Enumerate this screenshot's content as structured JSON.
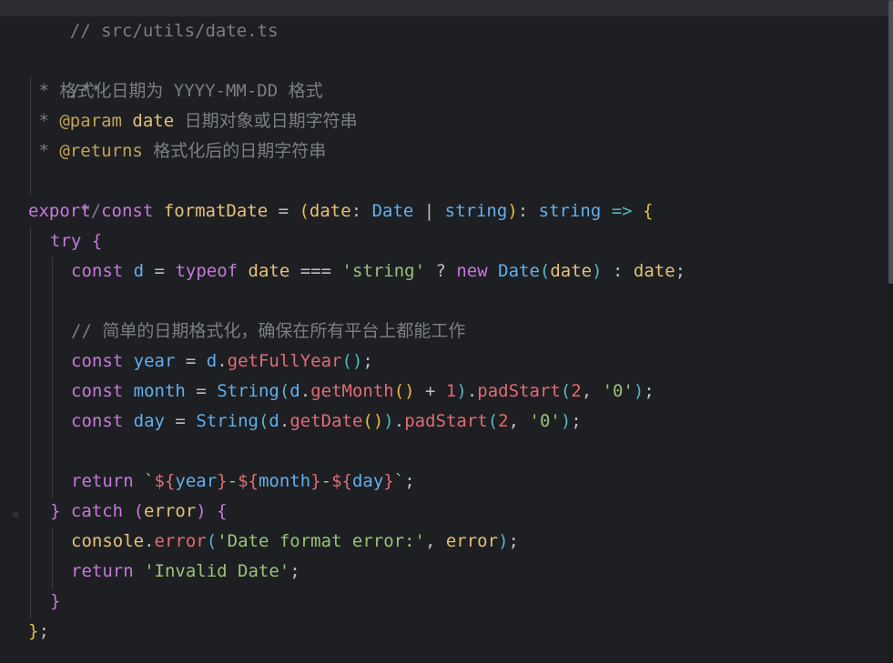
{
  "editor": {
    "file_path_comment": "// src/utils/date.ts",
    "doc": {
      "open": "/**",
      "line1_star": " * ",
      "line1_text": "格式化日期为 YYYY-MM-DD 格式",
      "line2_star": " * ",
      "line2_tag": "@param",
      "line2_name": "date",
      "line2_text": "日期对象或日期字符串",
      "line3_star": " * ",
      "line3_tag": "@returns",
      "line3_text": "格式化后的日期字符串",
      "close": " */"
    },
    "sig": {
      "export": "export",
      "const": "const",
      "name": "formatDate",
      "eq": " = ",
      "lp": "(",
      "param": "date",
      "colon": ": ",
      "type1": "Date",
      "bar": " | ",
      "type2": "string",
      "rp": ")",
      "colon2": ": ",
      "ret": "string",
      "arrow": " => ",
      "brace": "{"
    },
    "try_kw": "try",
    "try_brace": "{",
    "line_d": {
      "const": "const",
      "name": "d",
      "eq": " = ",
      "typeof": "typeof",
      "date": "date",
      "eqq": " === ",
      "str": "'string'",
      "q": " ? ",
      "new": "new",
      "Date": "Date",
      "lp": "(",
      "arg": "date",
      "rp": ")",
      "colon": " : ",
      "alt": "date",
      "semi": ";"
    },
    "comment2": "// 简单的日期格式化，确保在所有平台上都能工作",
    "line_year": {
      "const": "const",
      "name": "year",
      "eq": " = ",
      "obj": "d",
      "dot": ".",
      "meth": "getFullYear",
      "parens": "()",
      "semi": ";"
    },
    "line_month": {
      "const": "const",
      "name": "month",
      "eq": " = ",
      "String": "String",
      "lp": "(",
      "obj": "d",
      "dot": ".",
      "meth": "getMonth",
      "parens": "()",
      "plus": " + ",
      "one": "1",
      "rp": ")",
      "dot2": ".",
      "pad": "padStart",
      "lp2": "(",
      "two": "2",
      "comma": ", ",
      "zero": "'0'",
      "rp2": ")",
      "semi": ";"
    },
    "line_day": {
      "const": "const",
      "name": "day",
      "eq": " = ",
      "String": "String",
      "lp": "(",
      "obj": "d",
      "dot": ".",
      "meth": "getDate",
      "parens": "()",
      "rp": ")",
      "dot2": ".",
      "pad": "padStart",
      "lp2": "(",
      "two": "2",
      "comma": ", ",
      "zero": "'0'",
      "rp2": ")",
      "semi": ";"
    },
    "line_return": {
      "ret": "return",
      "tick1": " `",
      "d1": "${",
      "v1": "year",
      "e1": "}",
      "dash1": "-",
      "d2": "${",
      "v2": "month",
      "e2": "}",
      "dash2": "-",
      "d3": "${",
      "v3": "day",
      "e3": "}",
      "tick2": "`",
      "semi": ";"
    },
    "catch_line": {
      "rb": "}",
      "catch": "catch",
      "lp": "(",
      "err": "error",
      "rp": ")",
      "lb": "{"
    },
    "console_line": {
      "console": "console",
      "dot": ".",
      "meth": "error",
      "lp": "(",
      "msg": "'Date format error:'",
      "comma": ", ",
      "arg": "error",
      "rp": ")",
      "semi": ";"
    },
    "ret_invalid": {
      "ret": "return",
      "str": "'Invalid Date'",
      "semi": ";"
    },
    "close_catch": "}",
    "close_fn": "}",
    "close_fn_semi": ";"
  }
}
